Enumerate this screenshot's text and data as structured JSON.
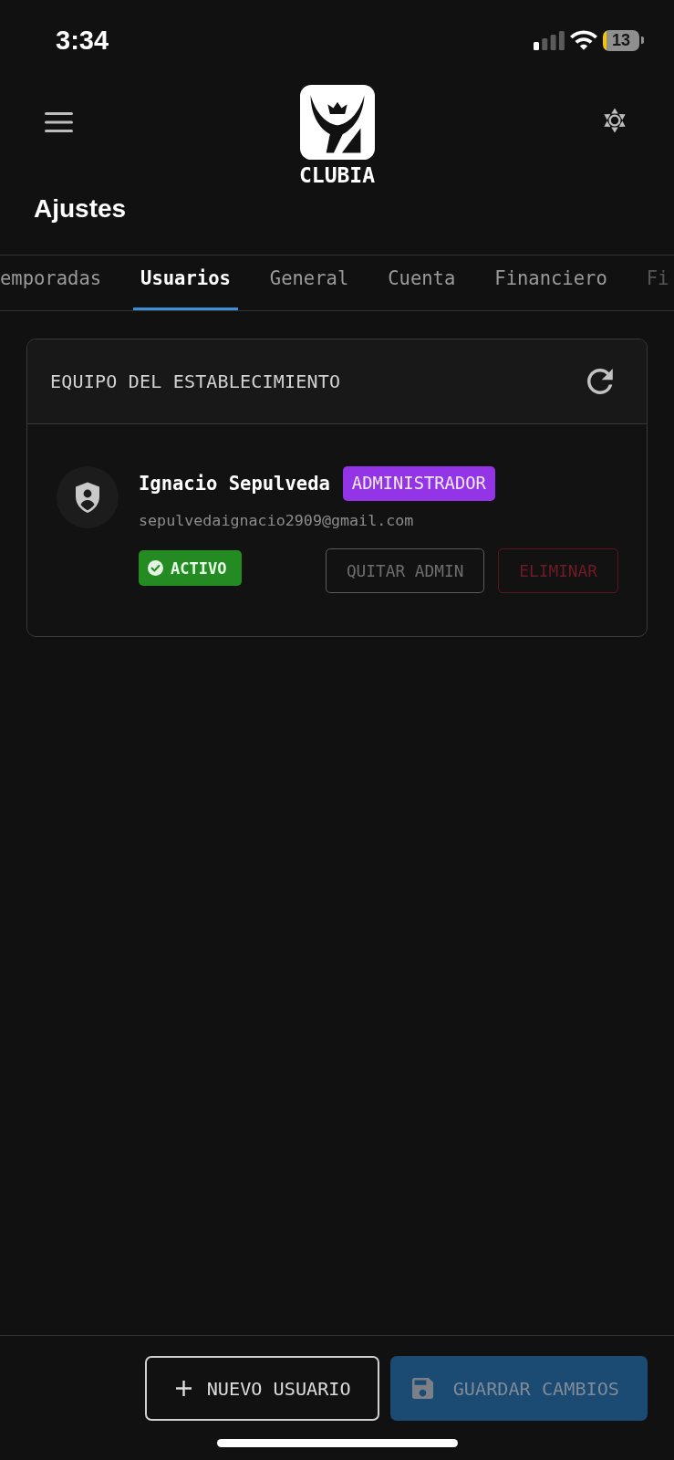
{
  "status_bar": {
    "time": "3:34",
    "battery": "13"
  },
  "header": {
    "logo_text": "CLUBIA",
    "title": "Ajustes"
  },
  "tabs": [
    {
      "label": "emporadas",
      "selected": false
    },
    {
      "label": "Usuarios",
      "selected": true
    },
    {
      "label": "General",
      "selected": false
    },
    {
      "label": "Cuenta",
      "selected": false
    },
    {
      "label": "Financiero",
      "selected": false
    },
    {
      "label": "Fi",
      "selected": false
    }
  ],
  "team_card": {
    "title": "EQUIPO DEL ESTABLECIMIENTO",
    "members": [
      {
        "name": "Ignacio Sepulveda",
        "role": "ADMINISTRADOR",
        "email": "sepulvedaignacio2909@gmail.com",
        "status": "ACTIVO",
        "actions": [
          {
            "label": "QUITAR ADMIN",
            "kind": "neutral",
            "disabled": true
          },
          {
            "label": "ELIMINAR",
            "kind": "danger",
            "disabled": true
          }
        ]
      }
    ]
  },
  "footer": {
    "buttons": [
      {
        "label": "NUEVO USUARIO",
        "kind": "add",
        "disabled": false
      },
      {
        "label": "GUARDAR CAMBIOS",
        "kind": "save",
        "disabled": true
      }
    ]
  }
}
